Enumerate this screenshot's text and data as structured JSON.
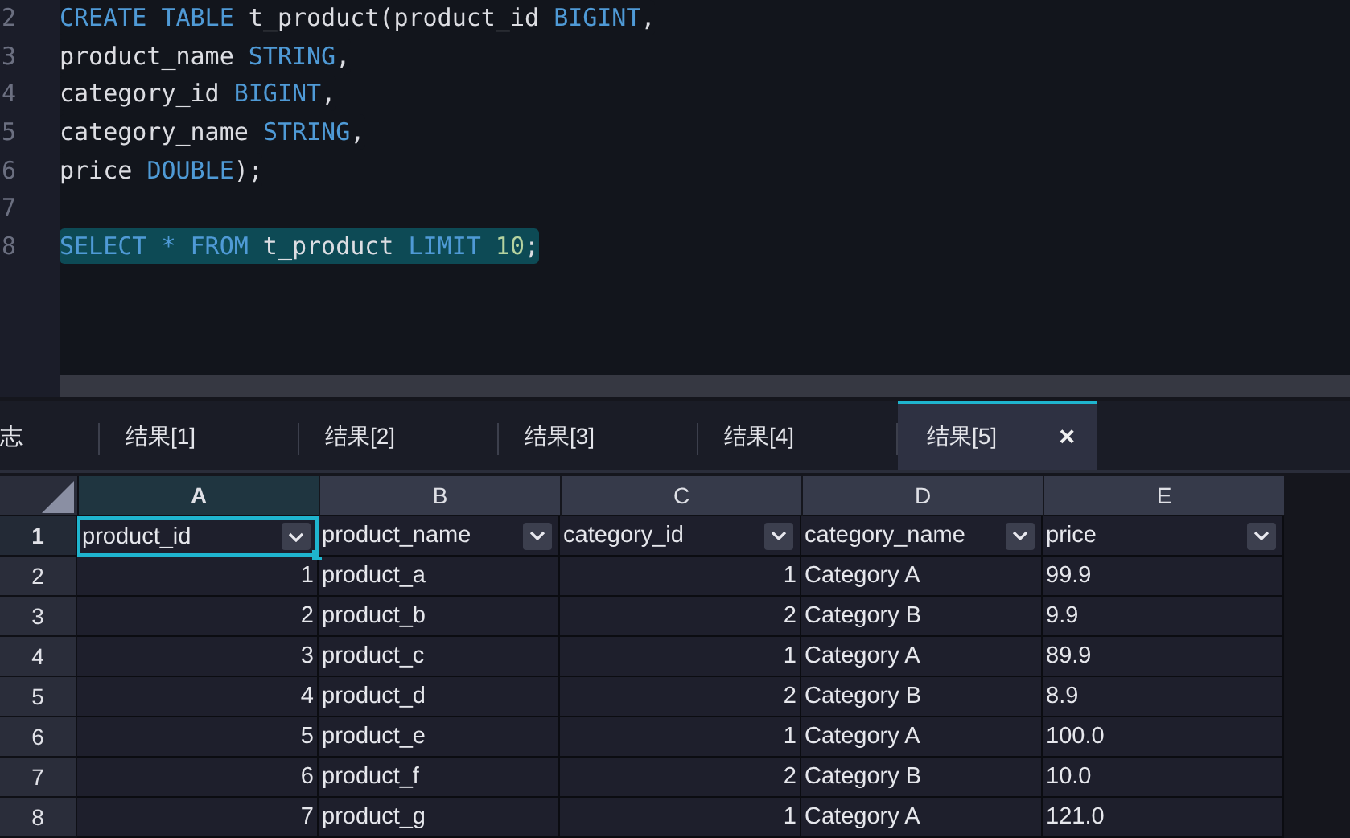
{
  "editor": {
    "lines": [
      {
        "number": "2",
        "selected": false,
        "tokens": [
          {
            "kind": "keyword",
            "text": "CREATE TABLE"
          },
          {
            "kind": "text",
            "text": " t_product(product_id "
          },
          {
            "kind": "keyword",
            "text": "BIGINT"
          },
          {
            "kind": "text",
            "text": ","
          }
        ]
      },
      {
        "number": "3",
        "selected": false,
        "tokens": [
          {
            "kind": "text",
            "text": "product_name "
          },
          {
            "kind": "keyword",
            "text": "STRING"
          },
          {
            "kind": "text",
            "text": ","
          }
        ]
      },
      {
        "number": "4",
        "selected": false,
        "tokens": [
          {
            "kind": "text",
            "text": "category_id "
          },
          {
            "kind": "keyword",
            "text": "BIGINT"
          },
          {
            "kind": "text",
            "text": ","
          }
        ]
      },
      {
        "number": "5",
        "selected": false,
        "tokens": [
          {
            "kind": "text",
            "text": "category_name "
          },
          {
            "kind": "keyword",
            "text": "STRING"
          },
          {
            "kind": "text",
            "text": ","
          }
        ]
      },
      {
        "number": "6",
        "selected": false,
        "tokens": [
          {
            "kind": "text",
            "text": "price "
          },
          {
            "kind": "keyword",
            "text": "DOUBLE"
          },
          {
            "kind": "text",
            "text": ");"
          }
        ]
      },
      {
        "number": "7"
      },
      {
        "number": "8",
        "selected": true,
        "tokens": [
          {
            "kind": "keyword",
            "text": "SELECT * FROM"
          },
          {
            "kind": "text",
            "text": " t_product "
          },
          {
            "kind": "keyword",
            "text": "LIMIT"
          },
          {
            "kind": "number",
            "text": " 10"
          },
          {
            "kind": "text",
            "text": ";"
          }
        ]
      }
    ]
  },
  "tabs": [
    {
      "label": "志",
      "selected": false
    },
    {
      "label": "结果[1]",
      "selected": false
    },
    {
      "label": "结果[2]",
      "selected": false
    },
    {
      "label": "结果[3]",
      "selected": false
    },
    {
      "label": "结果[4]",
      "selected": false
    },
    {
      "label": "结果[5]",
      "selected": true,
      "close": "×"
    }
  ],
  "sheet": {
    "columns": [
      {
        "letter": "A",
        "selected": true,
        "kind": "number"
      },
      {
        "letter": "B",
        "selected": false,
        "kind": "text"
      },
      {
        "letter": "C",
        "selected": false,
        "kind": "number"
      },
      {
        "letter": "D",
        "selected": false,
        "kind": "text"
      },
      {
        "letter": "E",
        "selected": false,
        "kind": "text"
      }
    ],
    "header_row": {
      "number": "1",
      "cells": [
        {
          "text": "product_id",
          "selected": true
        },
        {
          "text": "product_name",
          "selected": false
        },
        {
          "text": "category_id",
          "selected": false
        },
        {
          "text": "category_name",
          "selected": false
        },
        {
          "text": "price",
          "selected": false
        }
      ]
    },
    "rows": [
      {
        "number": "2",
        "cells": [
          "1",
          "product_a",
          "1",
          "Category A",
          "99.9"
        ]
      },
      {
        "number": "3",
        "cells": [
          "2",
          "product_b",
          "2",
          "Category B",
          "9.9"
        ]
      },
      {
        "number": "4",
        "cells": [
          "3",
          "product_c",
          "1",
          "Category A",
          "89.9"
        ]
      },
      {
        "number": "5",
        "cells": [
          "4",
          "product_d",
          "2",
          "Category B",
          "8.9"
        ]
      },
      {
        "number": "6",
        "cells": [
          "5",
          "product_e",
          "1",
          "Category A",
          "100.0"
        ]
      },
      {
        "number": "7",
        "cells": [
          "6",
          "product_f",
          "2",
          "Category B",
          "10.0"
        ]
      },
      {
        "number": "8",
        "cells": [
          "7",
          "product_g",
          "1",
          "Category A",
          "121.0"
        ]
      }
    ]
  }
}
